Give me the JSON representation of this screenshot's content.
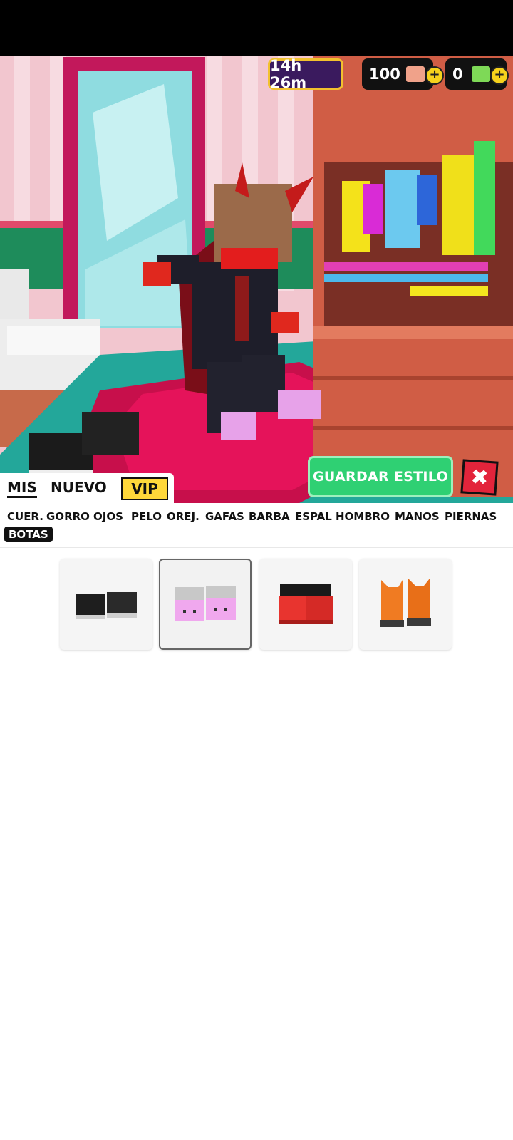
{
  "hud": {
    "timer": "14h 26m",
    "cubes": "100",
    "cash": "0"
  },
  "actions": {
    "save_label": "GUARDAR ESTILO",
    "close_label": "✖"
  },
  "tabs": {
    "mis": "MIS",
    "nuevo": "NUEVO",
    "vip": "VIP"
  },
  "categories": [
    "CUER.",
    "GORRO",
    "OJOS",
    "PELO",
    "OREJ.",
    "GAFAS",
    "BARBA",
    "ESPAL",
    "HOMBRO",
    "MANOS",
    "PIERNAS",
    "BOTAS"
  ],
  "selected_category": "BOTAS",
  "items": [
    {
      "name": "black-boots",
      "color": "#1e1e1e",
      "accent": "#cfcfcf"
    },
    {
      "name": "pink-bunny-slippers",
      "color": "#f0a8ee",
      "accent": "#c8c8c8",
      "selected": true
    },
    {
      "name": "red-devil-boots",
      "color": "#e8342f",
      "accent": "#1a1a1a"
    },
    {
      "name": "orange-fox-boots",
      "color": "#f07b22",
      "accent": "#3a3a3a"
    }
  ]
}
